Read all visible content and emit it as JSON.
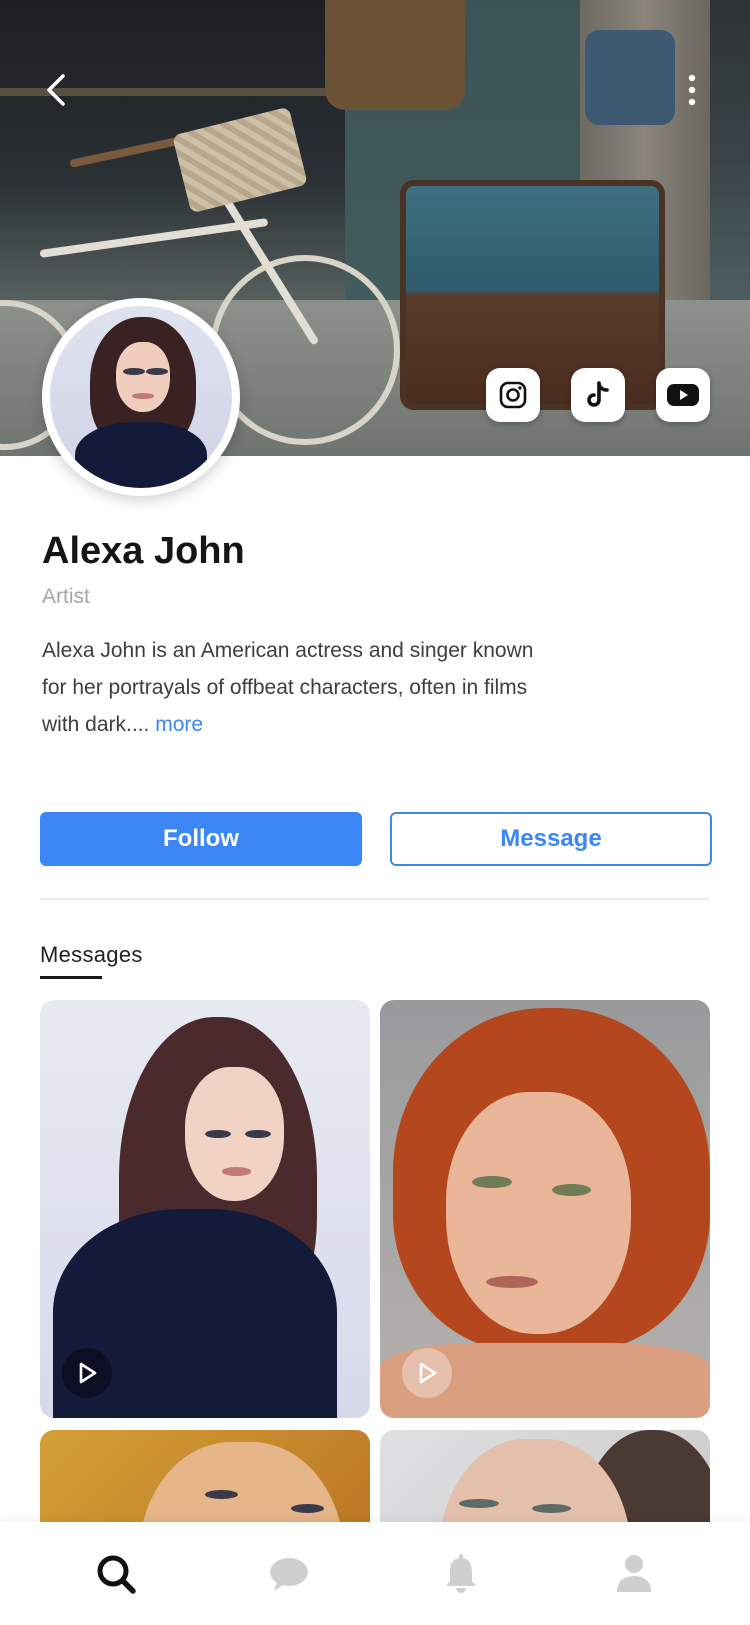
{
  "header": {
    "back_icon": "chevron-left-icon",
    "more_icon": "more-vertical-icon"
  },
  "social": [
    {
      "name": "instagram",
      "icon": "instagram-icon"
    },
    {
      "name": "tiktok",
      "icon": "tiktok-icon"
    },
    {
      "name": "youtube",
      "icon": "youtube-icon"
    }
  ],
  "profile": {
    "name": "Alexa John",
    "role": "Artist",
    "bio": "Alexa John  is an American actress and singer known for her portrayals of offbeat characters, often in films with dark....",
    "more_label": "more"
  },
  "actions": {
    "follow_label": "Follow",
    "message_label": "Message"
  },
  "tabs": {
    "active_label": "Messages"
  },
  "media": [
    {
      "type": "video",
      "icon": "play-icon"
    },
    {
      "type": "video",
      "icon": "play-icon"
    },
    {
      "type": "photo"
    },
    {
      "type": "photo"
    }
  ],
  "bottom_nav": [
    {
      "name": "search",
      "icon": "search-icon",
      "active": true
    },
    {
      "name": "chat",
      "icon": "chat-bubble-icon",
      "active": false
    },
    {
      "name": "notifications",
      "icon": "bell-icon",
      "active": false
    },
    {
      "name": "profile",
      "icon": "user-icon",
      "active": false
    }
  ],
  "colors": {
    "accent": "#3d86f5",
    "text_primary": "#151515",
    "text_secondary": "#a6a6a6",
    "nav_inactive": "#c9c9c9"
  }
}
